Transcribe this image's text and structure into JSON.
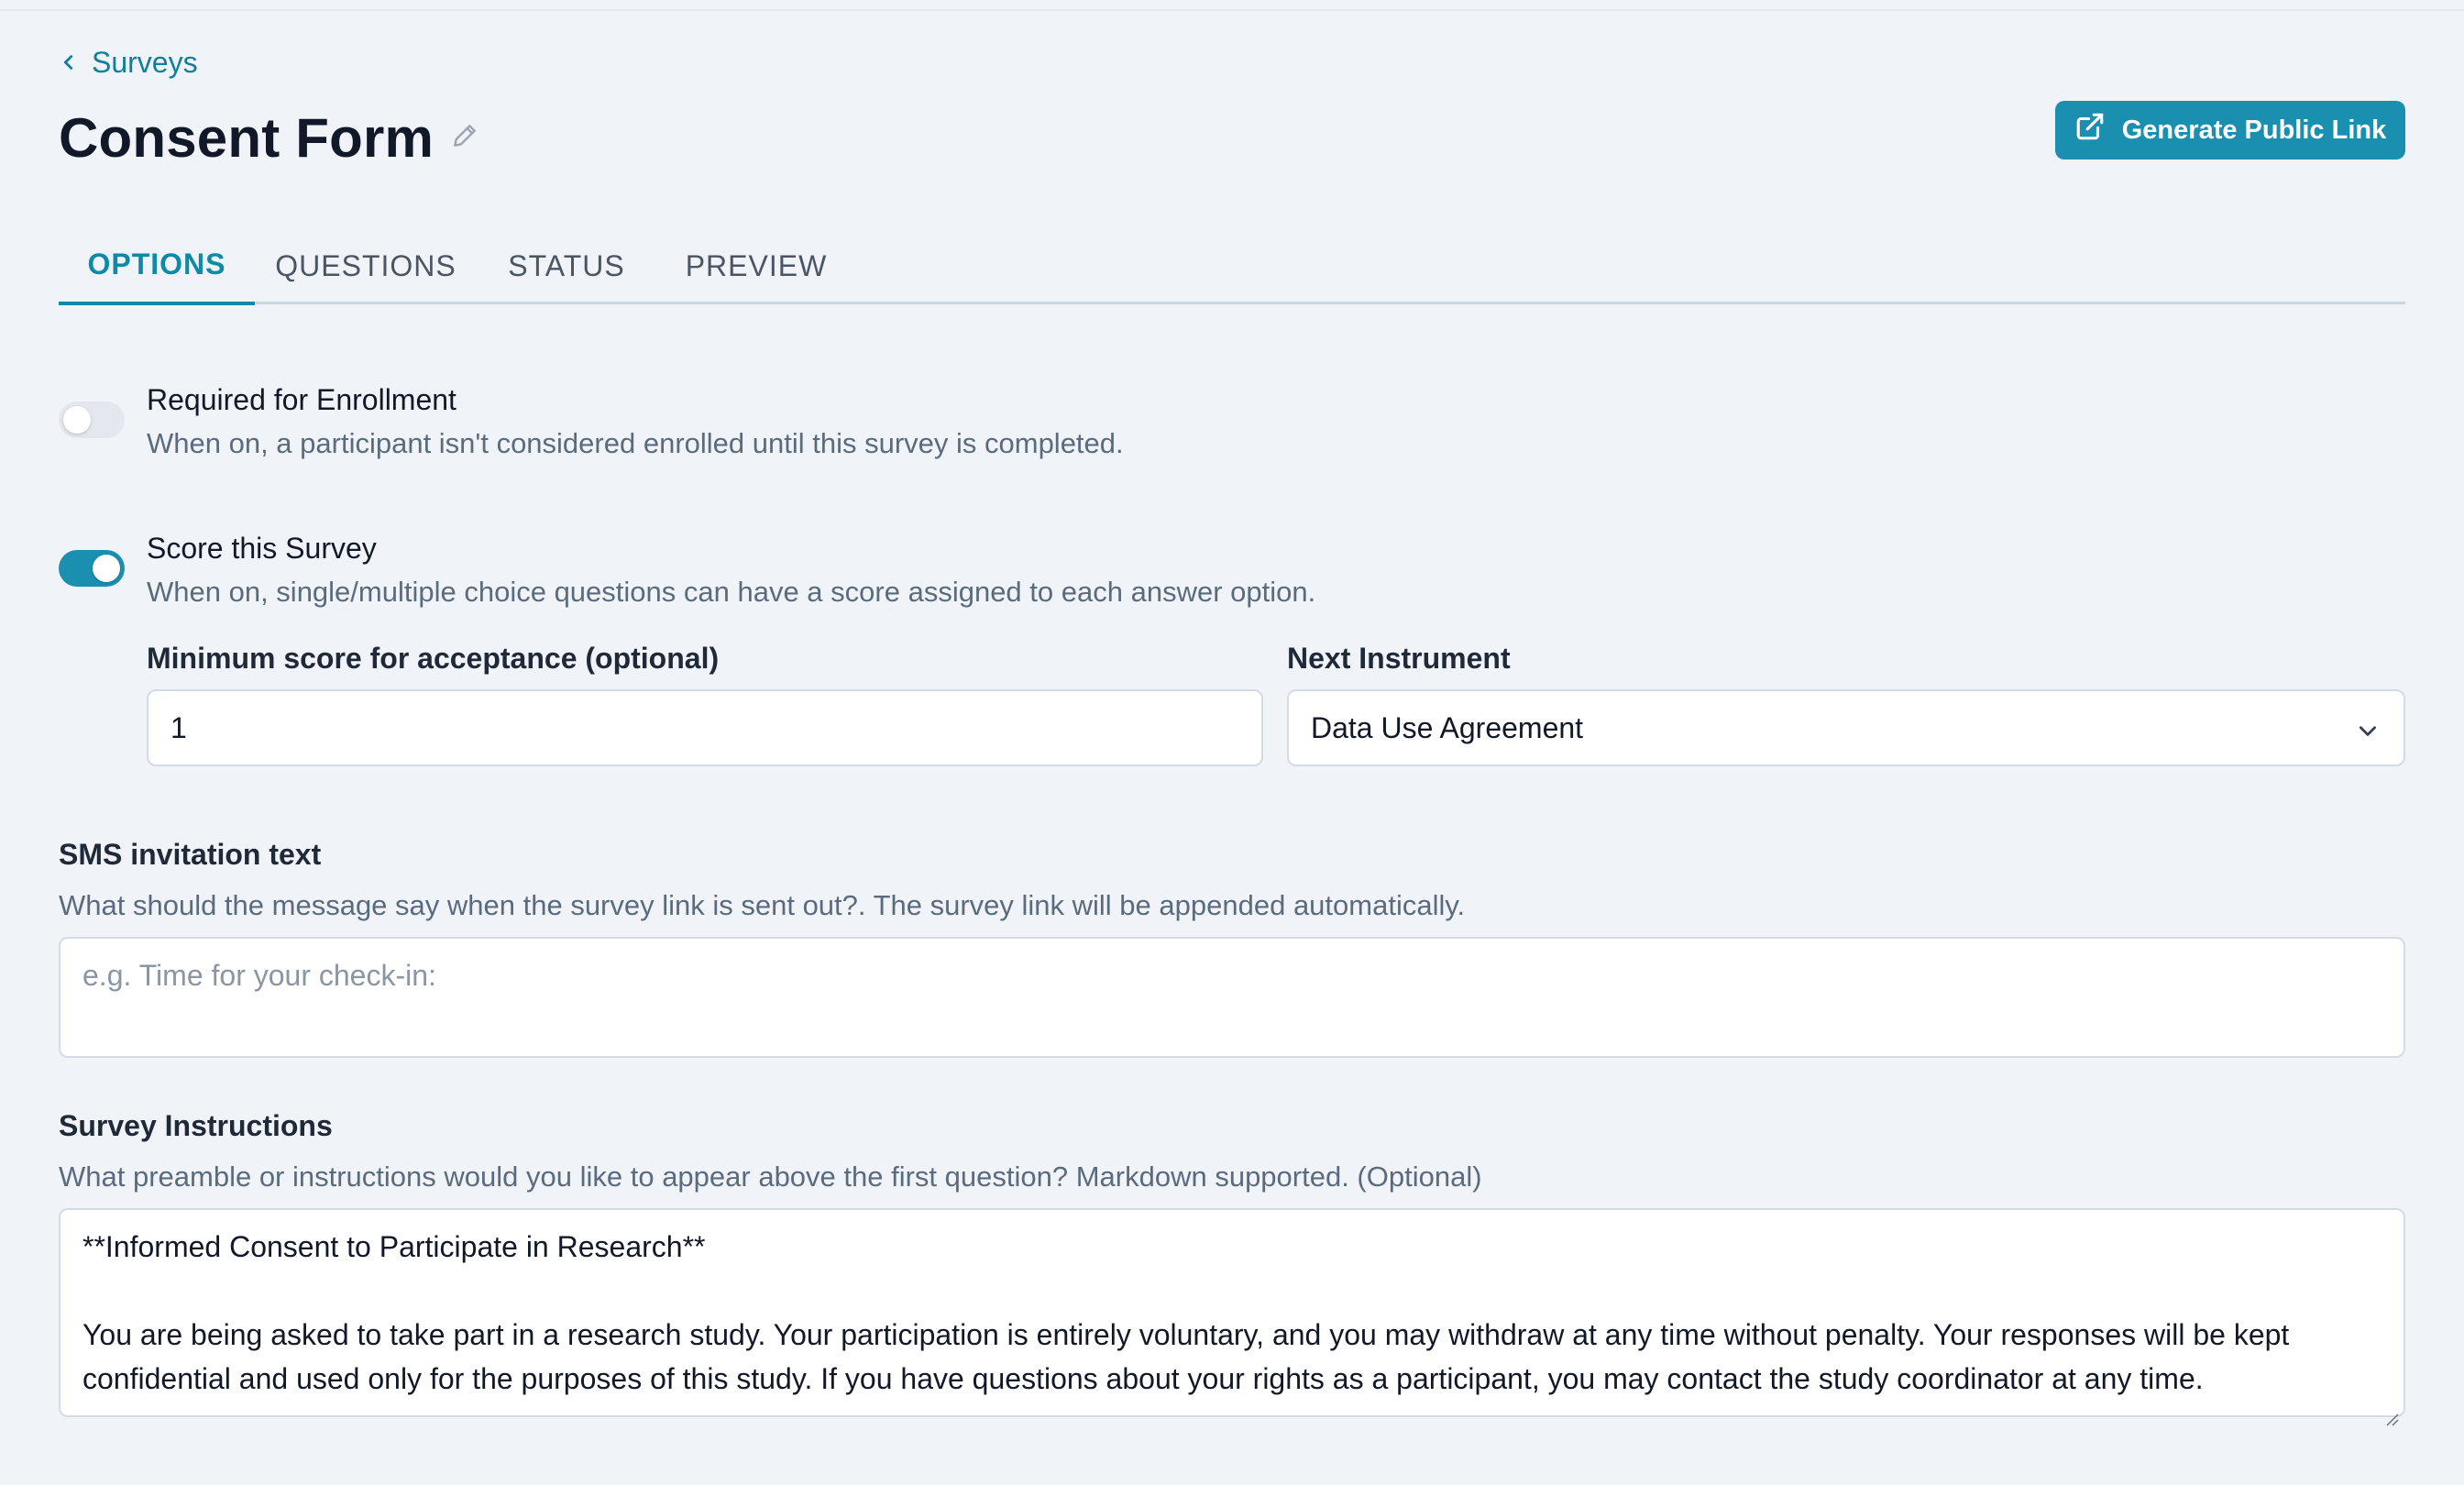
{
  "nav": {
    "back_label": "Surveys"
  },
  "header": {
    "title": "Consent Form",
    "public_link_button": "Generate Public Link"
  },
  "tabs": [
    {
      "label": "OPTIONS",
      "active": true
    },
    {
      "label": "QUESTIONS",
      "active": false
    },
    {
      "label": "STATUS",
      "active": false
    },
    {
      "label": "PREVIEW",
      "active": false
    }
  ],
  "options": {
    "required_enrollment": {
      "title": "Required for Enrollment",
      "description": "When on, a participant isn't considered enrolled until this survey is completed.",
      "enabled": false
    },
    "score_survey": {
      "title": "Score this Survey",
      "description": "When on, single/multiple choice questions can have a score assigned to each answer option.",
      "enabled": true
    },
    "min_score": {
      "label": "Minimum score for acceptance (optional)",
      "value": "1"
    },
    "next_instrument": {
      "label": "Next Instrument",
      "value": "Data Use Agreement"
    }
  },
  "sms": {
    "label": "SMS invitation text",
    "help": "What should the message say when the survey link is sent out?. The survey link will be appended automatically.",
    "placeholder": "e.g. Time for your check-in:",
    "value": ""
  },
  "instructions": {
    "label": "Survey Instructions",
    "help": "What preamble or instructions would you like to appear above the first question? Markdown supported. (Optional)",
    "line1": "**Informed Consent to Participate in Research**",
    "line2": "You are being asked to take part in a research study. Your participation is entirely voluntary, and you may withdraw at any time without penalty. Your responses will be kept confidential and used only for the purposes of this study. If you have questions about your rights as a participant, you may contact the study coordinator at any time."
  },
  "colors": {
    "accent": "#1b8fb0",
    "background": "#f0f4f9",
    "muted_text": "#5b6b7e"
  }
}
